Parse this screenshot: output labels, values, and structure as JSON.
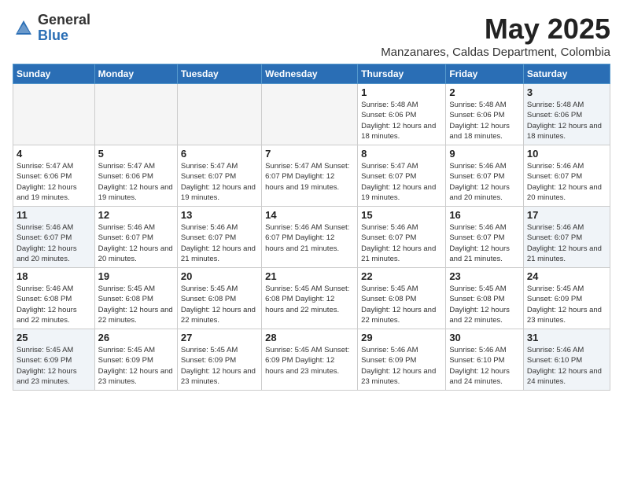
{
  "logo": {
    "general": "General",
    "blue": "Blue"
  },
  "title": "May 2025",
  "location": "Manzanares, Caldas Department, Colombia",
  "days_header": [
    "Sunday",
    "Monday",
    "Tuesday",
    "Wednesday",
    "Thursday",
    "Friday",
    "Saturday"
  ],
  "weeks": [
    [
      {
        "day": "",
        "info": ""
      },
      {
        "day": "",
        "info": ""
      },
      {
        "day": "",
        "info": ""
      },
      {
        "day": "",
        "info": ""
      },
      {
        "day": "1",
        "info": "Sunrise: 5:48 AM\nSunset: 6:06 PM\nDaylight: 12 hours\nand 18 minutes."
      },
      {
        "day": "2",
        "info": "Sunrise: 5:48 AM\nSunset: 6:06 PM\nDaylight: 12 hours\nand 18 minutes."
      },
      {
        "day": "3",
        "info": "Sunrise: 5:48 AM\nSunset: 6:06 PM\nDaylight: 12 hours\nand 18 minutes."
      }
    ],
    [
      {
        "day": "4",
        "info": "Sunrise: 5:47 AM\nSunset: 6:06 PM\nDaylight: 12 hours\nand 19 minutes."
      },
      {
        "day": "5",
        "info": "Sunrise: 5:47 AM\nSunset: 6:06 PM\nDaylight: 12 hours\nand 19 minutes."
      },
      {
        "day": "6",
        "info": "Sunrise: 5:47 AM\nSunset: 6:07 PM\nDaylight: 12 hours\nand 19 minutes."
      },
      {
        "day": "7",
        "info": "Sunrise: 5:47 AM\nSunset: 6:07 PM\nDaylight: 12 hours\nand 19 minutes."
      },
      {
        "day": "8",
        "info": "Sunrise: 5:47 AM\nSunset: 6:07 PM\nDaylight: 12 hours\nand 19 minutes."
      },
      {
        "day": "9",
        "info": "Sunrise: 5:46 AM\nSunset: 6:07 PM\nDaylight: 12 hours\nand 20 minutes."
      },
      {
        "day": "10",
        "info": "Sunrise: 5:46 AM\nSunset: 6:07 PM\nDaylight: 12 hours\nand 20 minutes."
      }
    ],
    [
      {
        "day": "11",
        "info": "Sunrise: 5:46 AM\nSunset: 6:07 PM\nDaylight: 12 hours\nand 20 minutes."
      },
      {
        "day": "12",
        "info": "Sunrise: 5:46 AM\nSunset: 6:07 PM\nDaylight: 12 hours\nand 20 minutes."
      },
      {
        "day": "13",
        "info": "Sunrise: 5:46 AM\nSunset: 6:07 PM\nDaylight: 12 hours\nand 21 minutes."
      },
      {
        "day": "14",
        "info": "Sunrise: 5:46 AM\nSunset: 6:07 PM\nDaylight: 12 hours\nand 21 minutes."
      },
      {
        "day": "15",
        "info": "Sunrise: 5:46 AM\nSunset: 6:07 PM\nDaylight: 12 hours\nand 21 minutes."
      },
      {
        "day": "16",
        "info": "Sunrise: 5:46 AM\nSunset: 6:07 PM\nDaylight: 12 hours\nand 21 minutes."
      },
      {
        "day": "17",
        "info": "Sunrise: 5:46 AM\nSunset: 6:07 PM\nDaylight: 12 hours\nand 21 minutes."
      }
    ],
    [
      {
        "day": "18",
        "info": "Sunrise: 5:46 AM\nSunset: 6:08 PM\nDaylight: 12 hours\nand 22 minutes."
      },
      {
        "day": "19",
        "info": "Sunrise: 5:45 AM\nSunset: 6:08 PM\nDaylight: 12 hours\nand 22 minutes."
      },
      {
        "day": "20",
        "info": "Sunrise: 5:45 AM\nSunset: 6:08 PM\nDaylight: 12 hours\nand 22 minutes."
      },
      {
        "day": "21",
        "info": "Sunrise: 5:45 AM\nSunset: 6:08 PM\nDaylight: 12 hours\nand 22 minutes."
      },
      {
        "day": "22",
        "info": "Sunrise: 5:45 AM\nSunset: 6:08 PM\nDaylight: 12 hours\nand 22 minutes."
      },
      {
        "day": "23",
        "info": "Sunrise: 5:45 AM\nSunset: 6:08 PM\nDaylight: 12 hours\nand 22 minutes."
      },
      {
        "day": "24",
        "info": "Sunrise: 5:45 AM\nSunset: 6:09 PM\nDaylight: 12 hours\nand 23 minutes."
      }
    ],
    [
      {
        "day": "25",
        "info": "Sunrise: 5:45 AM\nSunset: 6:09 PM\nDaylight: 12 hours\nand 23 minutes."
      },
      {
        "day": "26",
        "info": "Sunrise: 5:45 AM\nSunset: 6:09 PM\nDaylight: 12 hours\nand 23 minutes."
      },
      {
        "day": "27",
        "info": "Sunrise: 5:45 AM\nSunset: 6:09 PM\nDaylight: 12 hours\nand 23 minutes."
      },
      {
        "day": "28",
        "info": "Sunrise: 5:45 AM\nSunset: 6:09 PM\nDaylight: 12 hours\nand 23 minutes."
      },
      {
        "day": "29",
        "info": "Sunrise: 5:46 AM\nSunset: 6:09 PM\nDaylight: 12 hours\nand 23 minutes."
      },
      {
        "day": "30",
        "info": "Sunrise: 5:46 AM\nSunset: 6:10 PM\nDaylight: 12 hours\nand 24 minutes."
      },
      {
        "day": "31",
        "info": "Sunrise: 5:46 AM\nSunset: 6:10 PM\nDaylight: 12 hours\nand 24 minutes."
      }
    ]
  ]
}
